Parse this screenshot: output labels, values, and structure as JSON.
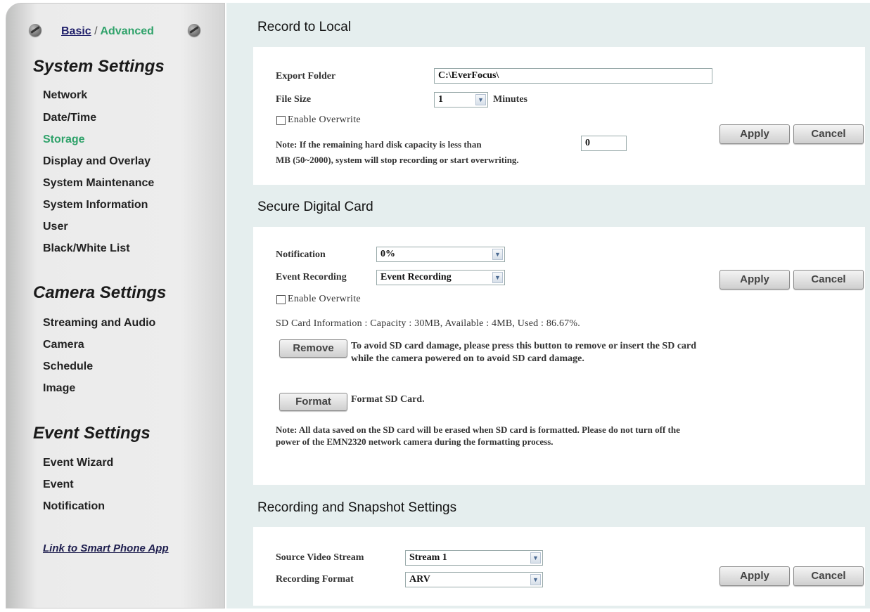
{
  "sidebar": {
    "mode_basic": "Basic",
    "mode_separator": "/",
    "mode_advanced": "Advanced",
    "system_heading": "System Settings",
    "system_items": [
      "Network",
      "Date/Time",
      "Storage",
      "Display and Overlay",
      "System Maintenance",
      "System Information",
      "User",
      "Black/White List"
    ],
    "camera_heading": "Camera Settings",
    "camera_items": [
      "Streaming and Audio",
      "Camera",
      "Schedule",
      "Image"
    ],
    "event_heading": "Event Settings",
    "event_items": [
      "Event Wizard",
      "Event",
      "Notification"
    ],
    "smart_link": "Link to Smart Phone App",
    "active_item": "Storage",
    "active_color": "#2fa26a"
  },
  "record_local": {
    "title": "Record to Local",
    "export_folder_label": "Export Folder",
    "export_folder_value": "C:\\EverFocus\\",
    "file_size_label": "File Size",
    "file_size_value": "1",
    "file_size_unit": "Minutes",
    "overwrite_label": "Enable Overwrite",
    "overwrite_checked": false,
    "note_prefix": "Note: If the remaining hard disk capacity is less than",
    "capacity_value": "0",
    "note_suffix": "MB (50~2000), system will stop recording or start overwriting.",
    "apply": "Apply",
    "cancel": "Cancel"
  },
  "sd_card": {
    "title": "Secure Digital Card",
    "notification_label": "Notification",
    "notification_value": "0%",
    "event_recording_label": "Event Recording",
    "event_recording_value": "Event Recording",
    "overwrite_label": "Enable Overwrite",
    "overwrite_checked": false,
    "info": "SD Card Information : Capacity : 30MB, Available : 4MB, Used : 86.67%.",
    "remove_button": "Remove",
    "remove_note": "To avoid SD card damage, please press this button to remove or insert the SD card while the camera powered on to avoid SD card damage.",
    "format_button": "Format",
    "format_note": "Format SD Card.",
    "format_warning": "Note: All data saved on the SD card will be erased when SD card is formatted. Please do not turn off the power of the EMN2320 network camera during the formatting process.",
    "apply": "Apply",
    "cancel": "Cancel"
  },
  "recording_snapshot": {
    "title": "Recording and Snapshot Settings",
    "source_label": "Source Video Stream",
    "source_value": "Stream 1",
    "format_label": "Recording Format",
    "format_value": "ARV",
    "apply": "Apply",
    "cancel": "Cancel"
  },
  "icons": {
    "screw": "screw-icon",
    "dropdown": "chevron-down-icon",
    "checkbox": "checkbox-icon"
  }
}
